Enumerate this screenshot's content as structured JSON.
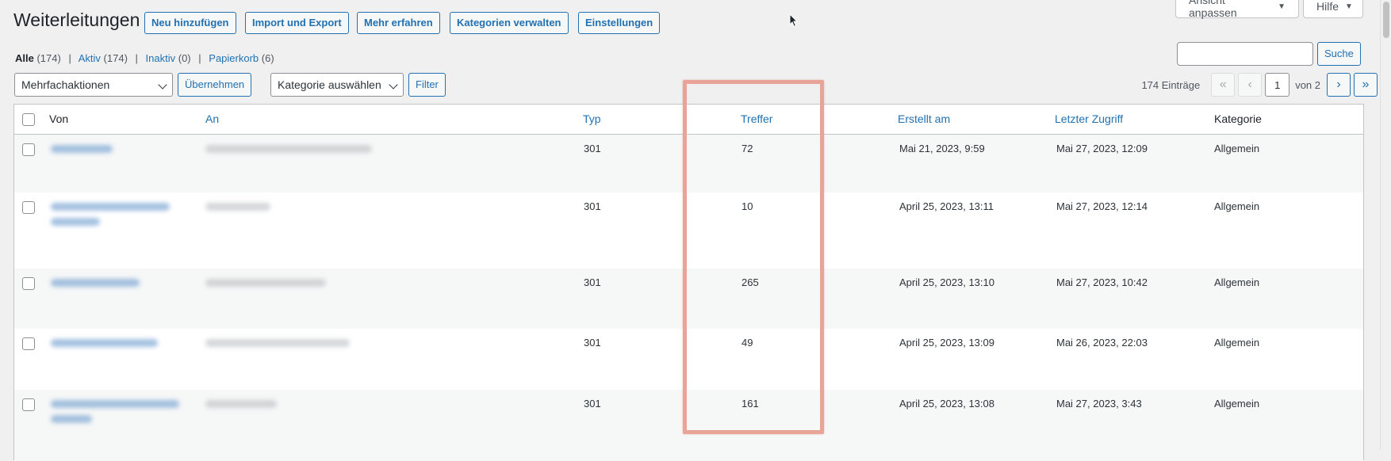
{
  "screen_options": {
    "ansicht_label": "Ansicht anpassen",
    "hilfe_label": "Hilfe"
  },
  "page": {
    "title": "Weiterleitungen"
  },
  "header_buttons": {
    "add": "Neu hinzufügen",
    "import": "Import und Export",
    "learn": "Mehr erfahren",
    "categories": "Kategorien verwalten",
    "settings": "Einstellungen"
  },
  "filters": {
    "all_label": "Alle",
    "all_count": "(174)",
    "active_label": "Aktiv",
    "active_count": "(174)",
    "inactive_label": "Inaktiv",
    "inactive_count": "(0)",
    "trash_label": "Papierkorb",
    "trash_count": "(6)",
    "separator": "|"
  },
  "search": {
    "button_label": "Suche",
    "value": ""
  },
  "bulk": {
    "select_value": "Mehrfachaktionen",
    "apply_label": "Übernehmen"
  },
  "category_filter": {
    "select_value": "Kategorie auswählen",
    "filter_label": "Filter"
  },
  "pagination": {
    "count_text": "174 Einträge",
    "first": "«",
    "prev": "‹",
    "current_page": "1",
    "of_text": "von 2",
    "next": "›",
    "last": "»"
  },
  "table": {
    "columns": {
      "from": "Von",
      "to": "An",
      "type": "Typ",
      "hits": "Treffer",
      "created": "Erstellt am",
      "last_access": "Letzter Zugriff",
      "category": "Kategorie"
    },
    "rows": [
      {
        "type": "301",
        "hits": "72",
        "created": "Mai 21, 2023, 9:59",
        "last_access": "Mai 27, 2023, 12:09",
        "category": "Allgemein"
      },
      {
        "type": "301",
        "hits": "10",
        "created": "April 25, 2023, 13:11",
        "last_access": "Mai 27, 2023, 12:14",
        "category": "Allgemein"
      },
      {
        "type": "301",
        "hits": "265",
        "created": "April 25, 2023, 13:10",
        "last_access": "Mai 27, 2023, 10:42",
        "category": "Allgemein"
      },
      {
        "type": "301",
        "hits": "49",
        "created": "April 25, 2023, 13:09",
        "last_access": "Mai 26, 2023, 22:03",
        "category": "Allgemein"
      },
      {
        "type": "301",
        "hits": "161",
        "created": "April 25, 2023, 13:08",
        "last_access": "Mai 27, 2023, 3:43",
        "category": "Allgemein"
      }
    ]
  },
  "colors": {
    "accent": "#2271b1",
    "highlight": "#e8a497",
    "background": "#f0f0f1"
  }
}
